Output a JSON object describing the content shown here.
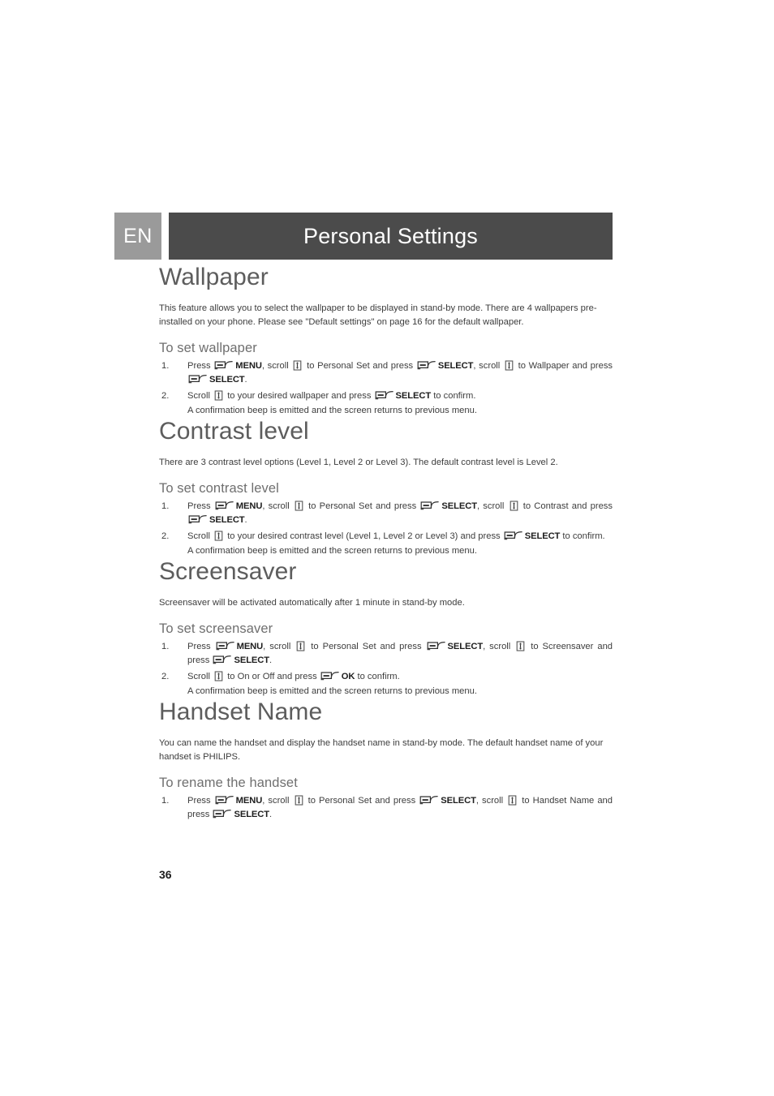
{
  "header": {
    "language_badge": "EN",
    "title": "Personal Settings",
    "badge_color": "#9a9a9a",
    "bar_color": "#4b4b4b"
  },
  "icons": {
    "softkey": "softkey-icon",
    "scroll": "scroll-key-icon"
  },
  "sections": [
    {
      "id": "wallpaper",
      "title": "Wallpaper",
      "intro": "This feature allows you to select the wallpaper to be displayed in stand-by mode. There are 4 wallpapers pre-installed on your phone. Please see \"Default settings\" on page 16 for the default wallpaper.",
      "subtitle": "To set wallpaper",
      "steps": [
        {
          "number": "1.",
          "parts": [
            {
              "t": "text",
              "v": "Press "
            },
            {
              "t": "softkey"
            },
            {
              "t": "bold",
              "v": "MENU"
            },
            {
              "t": "text",
              "v": ", scroll "
            },
            {
              "t": "scroll"
            },
            {
              "t": "text",
              "v": " to Personal Set and press "
            },
            {
              "t": "softkey"
            },
            {
              "t": "bold",
              "v": "SELECT"
            },
            {
              "t": "text",
              "v": ", scroll "
            },
            {
              "t": "scroll"
            },
            {
              "t": "text",
              "v": " to Wallpaper and press "
            },
            {
              "t": "softkey"
            },
            {
              "t": "bold",
              "v": "SELECT"
            },
            {
              "t": "text",
              "v": "."
            }
          ]
        },
        {
          "number": "2.",
          "parts": [
            {
              "t": "text",
              "v": "Scroll "
            },
            {
              "t": "scroll"
            },
            {
              "t": "text",
              "v": " to your desired wallpaper and press "
            },
            {
              "t": "softkey"
            },
            {
              "t": "bold",
              "v": "SELECT"
            },
            {
              "t": "text",
              "v": " to confirm."
            },
            {
              "t": "break"
            },
            {
              "t": "text",
              "v": "A confirmation beep is emitted and the screen returns to previous menu."
            }
          ]
        }
      ]
    },
    {
      "id": "contrast-level",
      "title": "Contrast level",
      "intro": "There are 3 contrast level options (Level 1, Level 2 or Level 3). The default contrast level is Level 2.",
      "subtitle": "To set contrast level",
      "steps": [
        {
          "number": "1.",
          "parts": [
            {
              "t": "text",
              "v": "Press "
            },
            {
              "t": "softkey"
            },
            {
              "t": "bold",
              "v": "MENU"
            },
            {
              "t": "text",
              "v": ", scroll "
            },
            {
              "t": "scroll"
            },
            {
              "t": "text",
              "v": " to Personal Set and press "
            },
            {
              "t": "softkey"
            },
            {
              "t": "bold",
              "v": "SELECT"
            },
            {
              "t": "text",
              "v": ", scroll "
            },
            {
              "t": "scroll"
            },
            {
              "t": "text",
              "v": " to Contrast and press "
            },
            {
              "t": "softkey"
            },
            {
              "t": "bold",
              "v": "SELECT"
            },
            {
              "t": "text",
              "v": "."
            }
          ]
        },
        {
          "number": "2.",
          "parts": [
            {
              "t": "text",
              "v": "Scroll "
            },
            {
              "t": "scroll"
            },
            {
              "t": "text",
              "v": " to your desired contrast level (Level 1, Level 2 or Level 3) and press "
            },
            {
              "t": "softkey"
            },
            {
              "t": "bold",
              "v": "SELECT"
            },
            {
              "t": "text",
              "v": " to confirm."
            },
            {
              "t": "break"
            },
            {
              "t": "text",
              "v": "A confirmation beep is emitted and the screen returns to previous menu."
            }
          ]
        }
      ]
    },
    {
      "id": "screensaver",
      "title": "Screensaver",
      "intro": "Screensaver will be activated automatically after 1 minute in stand-by mode.",
      "subtitle": "To set screensaver",
      "steps": [
        {
          "number": "1.",
          "parts": [
            {
              "t": "text",
              "v": "Press "
            },
            {
              "t": "softkey"
            },
            {
              "t": "bold",
              "v": "MENU"
            },
            {
              "t": "text",
              "v": ", scroll "
            },
            {
              "t": "scroll"
            },
            {
              "t": "text",
              "v": " to Personal Set and press "
            },
            {
              "t": "softkey"
            },
            {
              "t": "bold",
              "v": "SELECT"
            },
            {
              "t": "text",
              "v": ", scroll "
            },
            {
              "t": "scroll"
            },
            {
              "t": "text",
              "v": " to Screensaver and press "
            },
            {
              "t": "softkey"
            },
            {
              "t": "bold",
              "v": "SELECT"
            },
            {
              "t": "text",
              "v": "."
            }
          ]
        },
        {
          "number": "2.",
          "parts": [
            {
              "t": "text",
              "v": "Scroll "
            },
            {
              "t": "scroll"
            },
            {
              "t": "text",
              "v": " to On or Off and press "
            },
            {
              "t": "softkey"
            },
            {
              "t": "bold",
              "v": "OK"
            },
            {
              "t": "text",
              "v": " to confirm."
            },
            {
              "t": "break"
            },
            {
              "t": "text",
              "v": "A confirmation beep is emitted and the screen returns to previous menu."
            }
          ]
        }
      ]
    },
    {
      "id": "handset-name",
      "title": "Handset Name",
      "intro": "You can name the handset and display the handset name in stand-by mode. The default handset name of your handset is PHILIPS.",
      "subtitle": "To rename the handset",
      "steps": [
        {
          "number": "1.",
          "parts": [
            {
              "t": "text",
              "v": "Press "
            },
            {
              "t": "softkey"
            },
            {
              "t": "bold",
              "v": "MENU"
            },
            {
              "t": "text",
              "v": ", scroll "
            },
            {
              "t": "scroll"
            },
            {
              "t": "text",
              "v": " to Personal Set and press "
            },
            {
              "t": "softkey"
            },
            {
              "t": "bold",
              "v": "SELECT"
            },
            {
              "t": "text",
              "v": ", scroll "
            },
            {
              "t": "scroll"
            },
            {
              "t": "text",
              "v": " to Handset Name and press "
            },
            {
              "t": "softkey"
            },
            {
              "t": "bold",
              "v": "SELECT"
            },
            {
              "t": "text",
              "v": "."
            }
          ]
        }
      ]
    }
  ],
  "footer": {
    "page_number": "36"
  }
}
